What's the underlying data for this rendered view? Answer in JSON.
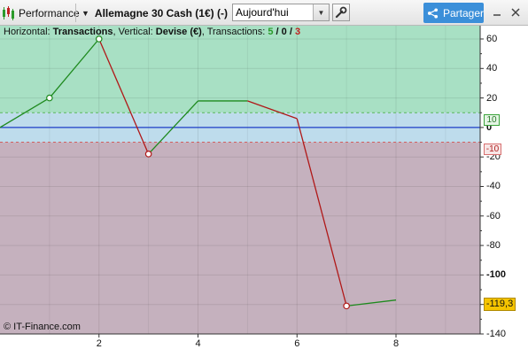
{
  "toolbar": {
    "performance_label": "Performance",
    "instrument_label": "Allemagne 30 Cash (1€) (-)",
    "period_value": "Aujourd'hui",
    "share_label": "Partager"
  },
  "legend": {
    "horizontal_prefix": "Horizontal: ",
    "horizontal_value": "Transactions",
    "vertical_prefix": ", Vertical: ",
    "vertical_value": "Devise (€)",
    "transactions_prefix": ", Transactions: ",
    "wins": "5",
    "sep1": " / ",
    "neutral": "0",
    "sep2": " / ",
    "losses": "3"
  },
  "copyright": "© IT-Finance.com",
  "bounds": {
    "upper": "10",
    "lower": "-10"
  },
  "current_value_label": "-119,3",
  "colors": {
    "gain_zone": "#a8e0c4",
    "neutral_zone": "#bedcec",
    "loss_zone": "#c5b1be",
    "gain_line": "#1e8a1e",
    "loss_line": "#b01818",
    "zero_line": "#1c3fc8",
    "current_label": "#f5c400"
  },
  "chart_data": {
    "type": "line",
    "x": [
      0,
      1,
      2,
      3,
      4,
      5,
      6,
      7,
      8
    ],
    "values": [
      0,
      20,
      60,
      -18,
      18,
      18,
      6,
      -121,
      -117
    ],
    "markers": [
      {
        "x": 1,
        "y": 20,
        "kind": "win"
      },
      {
        "x": 2,
        "y": 60,
        "kind": "win"
      },
      {
        "x": 3,
        "y": -18,
        "kind": "loss"
      },
      {
        "x": 7,
        "y": -121,
        "kind": "loss"
      }
    ],
    "x_ticks": [
      "2",
      "4",
      "6",
      "8"
    ],
    "y_ticks": [
      "60",
      "40",
      "20",
      "0",
      "-20",
      "-40",
      "-60",
      "-80",
      "-100",
      "-120",
      "-140"
    ],
    "xlim": [
      0,
      9.7
    ],
    "ylim": [
      -140,
      69
    ],
    "zones": {
      "upper": 10,
      "lower": -10
    }
  }
}
